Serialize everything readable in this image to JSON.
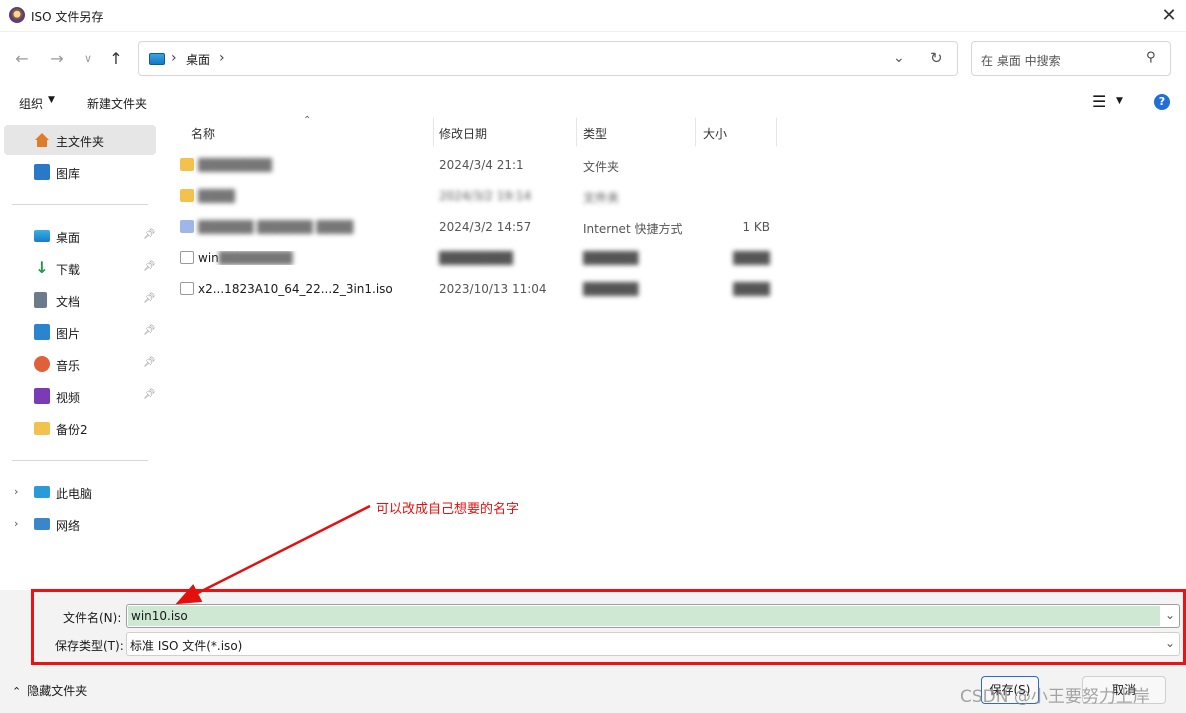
{
  "window": {
    "title": "ISO 文件另存"
  },
  "address": {
    "crumb": "桌面",
    "sep": "›"
  },
  "search": {
    "placeholder": "在 桌面 中搜索"
  },
  "toolbar": {
    "organize": "组织",
    "new_folder": "新建文件夹"
  },
  "sidebar": {
    "home": "主文件夹",
    "gallery": "图库",
    "quick": [
      {
        "label": "桌面"
      },
      {
        "label": "下载"
      },
      {
        "label": "文档"
      },
      {
        "label": "图片"
      },
      {
        "label": "音乐"
      },
      {
        "label": "视频"
      },
      {
        "label": "备份2"
      }
    ],
    "this_pc": "此电脑",
    "network": "网络"
  },
  "columns": {
    "name": "名称",
    "date": "修改日期",
    "type": "类型",
    "size": "大小"
  },
  "files": [
    {
      "name": "",
      "date": "2024/3/4 21:1",
      "type": "文件夹",
      "size": "",
      "icon": "folder-icon"
    },
    {
      "name": "",
      "date": "2024/3/2 19:14",
      "type": "文件夹",
      "size": "",
      "icon": "folder-icon"
    },
    {
      "name": "",
      "date": "2024/3/2 14:57",
      "type": "Internet 快捷方式",
      "size": "1 KB",
      "icon": "shortcut-icon"
    },
    {
      "name": "win",
      "date": "",
      "type": "",
      "size": "",
      "icon": "file-icon"
    },
    {
      "name": "x2...1823A10_64_22...2_3in1.iso",
      "date": "2023/10/13 11:04",
      "type": "",
      "size": "",
      "icon": "file-icon"
    }
  ],
  "annotation": {
    "text": "可以改成自己想要的名字",
    "color": "#e31010"
  },
  "form": {
    "filename_label": "文件名(N):",
    "filename_value": "win10.iso",
    "type_label": "保存类型(T):",
    "type_value": "标准 ISO 文件(*.iso)"
  },
  "footer": {
    "hide_folders": "隐藏文件夹",
    "save": "保存(S)",
    "cancel": "取消"
  },
  "watermark": "CSDN @小王要努力上岸"
}
